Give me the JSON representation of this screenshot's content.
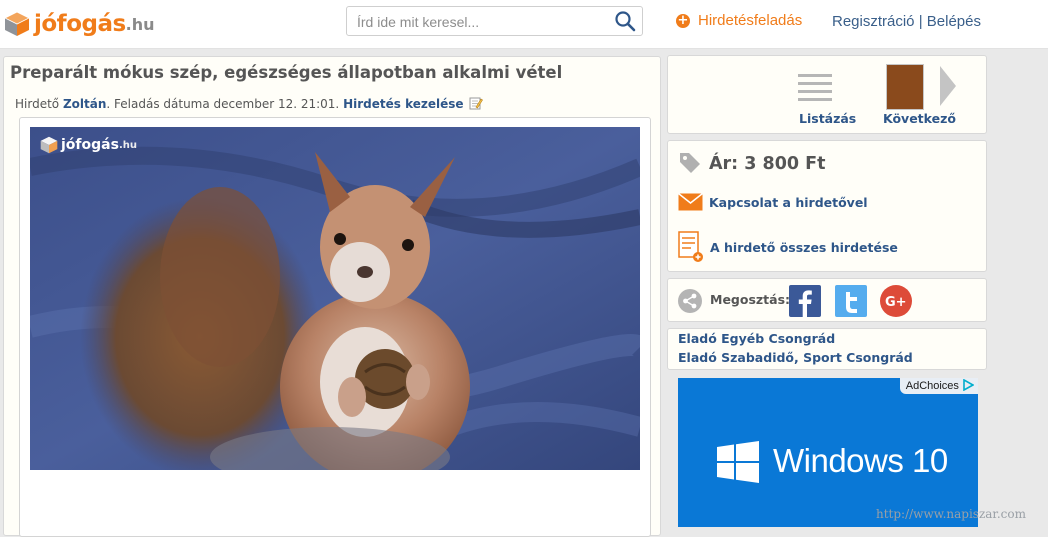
{
  "header": {
    "logo_text": "jófogás",
    "logo_suffix": ".hu",
    "search_placeholder": "Írd ide mit keresel...",
    "post_ad_label": "Hirdetésfeladás",
    "register_label": "Regisztráció",
    "separator": "|",
    "login_label": "Belépés"
  },
  "listing": {
    "title": "Preparált mókus szép, egészséges állapotban alkalmi vétel",
    "advertiser_prefix": "Hirdető",
    "advertiser_name": "Zoltán",
    "posted_text": ". Feladás dátuma december 12. 21:01.",
    "manage_label": "Hirdetés kezelése",
    "photo_watermark_text": "jófogás",
    "photo_watermark_suffix": ".hu"
  },
  "nav": {
    "list_label": "Listázás",
    "next_label": "Következő"
  },
  "price_box": {
    "price": "Ár: 3 800 Ft",
    "contact_label": "Kapcsolat a hirdetővel",
    "all_ads_label": "A hirdető összes hirdetése"
  },
  "share": {
    "label": "Megosztás:"
  },
  "categories": [
    "Eladó Egyéb Csongrád",
    "Eladó Szabadidő, Sport Csongrád"
  ],
  "ad": {
    "adchoices_label": "AdChoices",
    "product": "Windows 10"
  },
  "watermark": "http://www.napiszar.com",
  "colors": {
    "brand_orange": "#f07c1a",
    "link_blue": "#2e5689",
    "facebook": "#3b5998",
    "twitter": "#55acee",
    "google_plus": "#dd4b39",
    "windows_blue": "#0a78d6"
  },
  "icons": [
    "logo-box-icon",
    "search-icon",
    "plus-icon",
    "edit-icon",
    "list-icon",
    "next-arrow-icon",
    "price-tag-icon",
    "envelope-icon",
    "document-icon",
    "share-icon",
    "facebook-icon",
    "twitter-icon",
    "google-plus-icon",
    "adchoices-icon",
    "windows-logo-icon"
  ]
}
